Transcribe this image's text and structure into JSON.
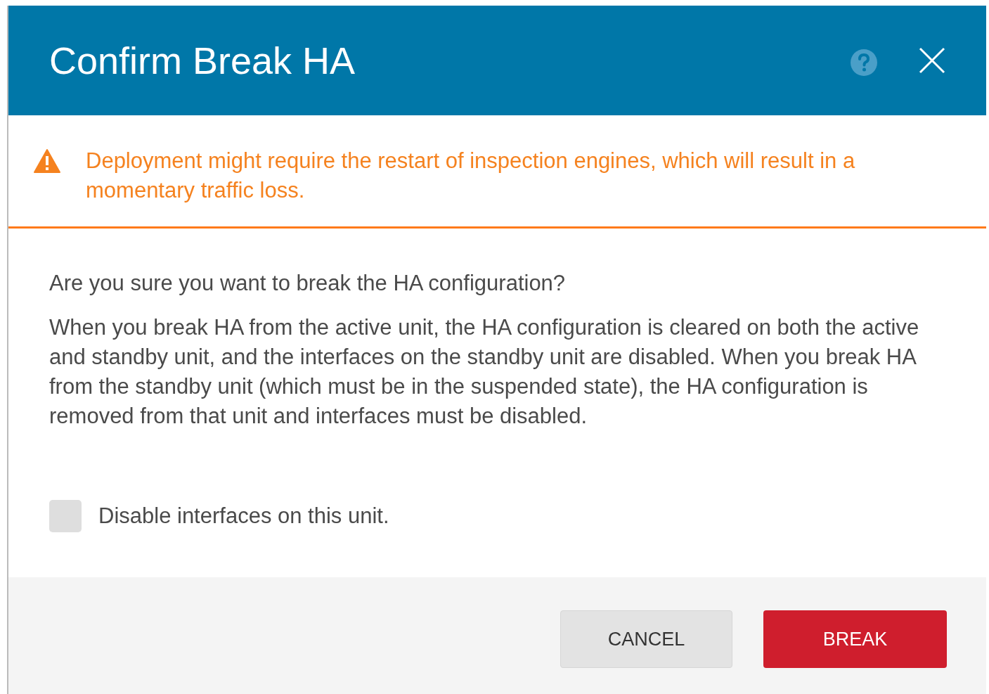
{
  "dialog": {
    "title": "Confirm Break HA"
  },
  "warning": {
    "text": "Deployment might require the restart of inspection engines, which will result in a momentary traffic loss."
  },
  "question": "Are you sure you want to break the HA configuration?",
  "description": "When you break HA from the active unit, the HA configuration is cleared on both the active and standby unit, and the interfaces on the standby unit are disabled. When you break HA from the standby unit (which must be in the suspended state), the HA configuration is removed from that unit and interfaces must be disabled.",
  "checkbox": {
    "label": "Disable interfaces on this unit.",
    "checked": false
  },
  "buttons": [
    {
      "label": "CANCEL",
      "kind": "secondary"
    },
    {
      "label": "BREAK",
      "kind": "primary"
    }
  ]
}
